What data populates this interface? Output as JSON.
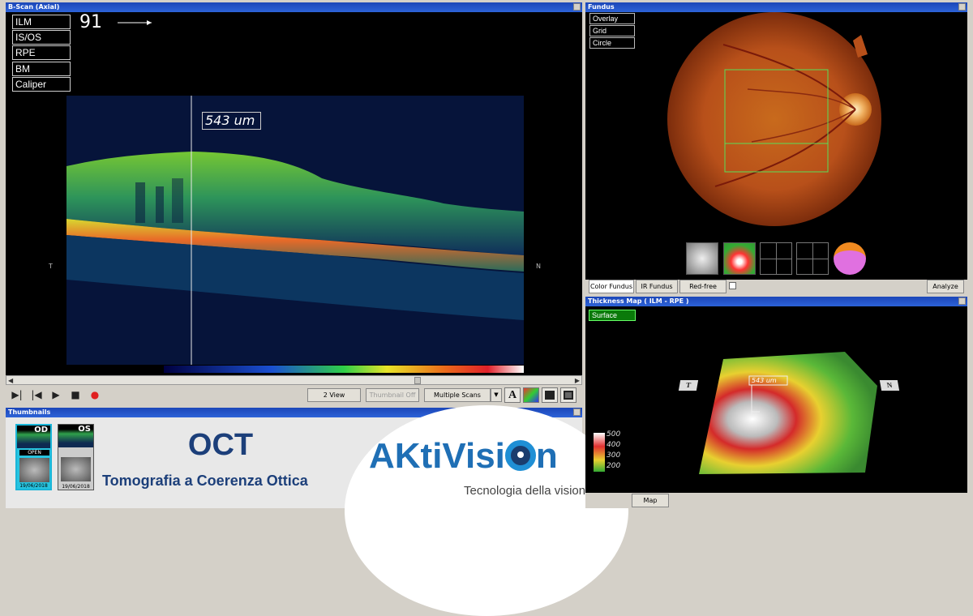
{
  "bscan": {
    "title": "B-Scan (Axial)",
    "layers": [
      "ILM",
      "IS/OS",
      "RPE",
      "BM",
      "Caliper"
    ],
    "slice_number": "91",
    "measurement": "543 um",
    "temporal_label": "T",
    "nasal_label": "N"
  },
  "controls": {
    "view_button": "2 View",
    "thumbnail_button": "Thumbnail Off",
    "scan_select": "Multiple Scans",
    "text_tool": "A"
  },
  "thumbnails": {
    "title": "Thumbnails",
    "items": [
      {
        "eye": "OD",
        "status": "OPEN",
        "date": "19/06/2018"
      },
      {
        "eye": "OS",
        "status": "",
        "date": "19/06/2018"
      }
    ]
  },
  "promo": {
    "title": "OCT",
    "subtitle": "Tomografia a Coerenza Ottica",
    "brand_part1": "AKtiVisi",
    "brand_part2": "n",
    "tagline": "Tecnologia della visione",
    "brand_color": "#1f6fb5",
    "title_color": "#1c3f7a"
  },
  "fundus": {
    "title": "Fundus",
    "buttons": [
      "Overlay",
      "Grid",
      "Circle"
    ],
    "tabs": [
      "Color Fundus",
      "IR Fundus",
      "Red-free"
    ],
    "analyze_button": "Analyze"
  },
  "thickness_map": {
    "title": "Thickness Map   ( ILM - RPE )",
    "surface_button": "Surface",
    "measurement": "543 um",
    "temporal_marker": "T",
    "nasal_marker": "N",
    "scale_values": [
      "500",
      "400",
      "300",
      "200"
    ],
    "bottom_tabs": [
      "Map"
    ]
  }
}
